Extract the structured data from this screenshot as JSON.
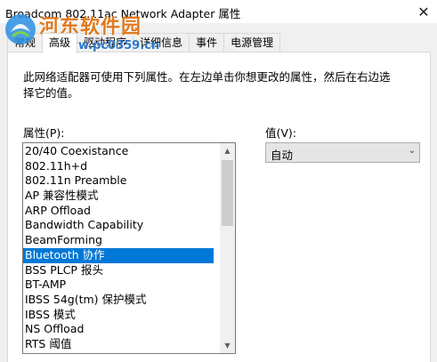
{
  "window": {
    "title": "Broadcom 802.11ac Network Adapter 属性",
    "close_glyph": "✕"
  },
  "watermark": {
    "site_name": "河东软件园",
    "url": "www.pc0359.cn"
  },
  "tabs": [
    {
      "label": "常规",
      "active": false
    },
    {
      "label": "高级",
      "active": true
    },
    {
      "label": "驱动程序",
      "active": false
    },
    {
      "label": "详细信息",
      "active": false
    },
    {
      "label": "事件",
      "active": false
    },
    {
      "label": "电源管理",
      "active": false
    }
  ],
  "advanced": {
    "description": "此网络适配器可使用下列属性。在左边单击你想更改的属性，然后在右边选择它的值。",
    "property_label": "属性(P):",
    "value_label": "值(V):",
    "properties": [
      "20/40 Coexistance",
      "802.11h+d",
      "802.11n Preamble",
      "AP 兼容性模式",
      "ARP Offload",
      "Bandwidth Capability",
      "BeamForming",
      "Bluetooth 协作",
      "BSS PLCP 报头",
      "BT-AMP",
      "IBSS 54g(tm) 保护模式",
      "IBSS 模式",
      "NS Offload",
      "RTS 阈值"
    ],
    "selected_index": 7,
    "value_selected": "自动"
  },
  "icons": {
    "scroll_up": "▲",
    "scroll_down": "▼",
    "dropdown": "⌄"
  }
}
